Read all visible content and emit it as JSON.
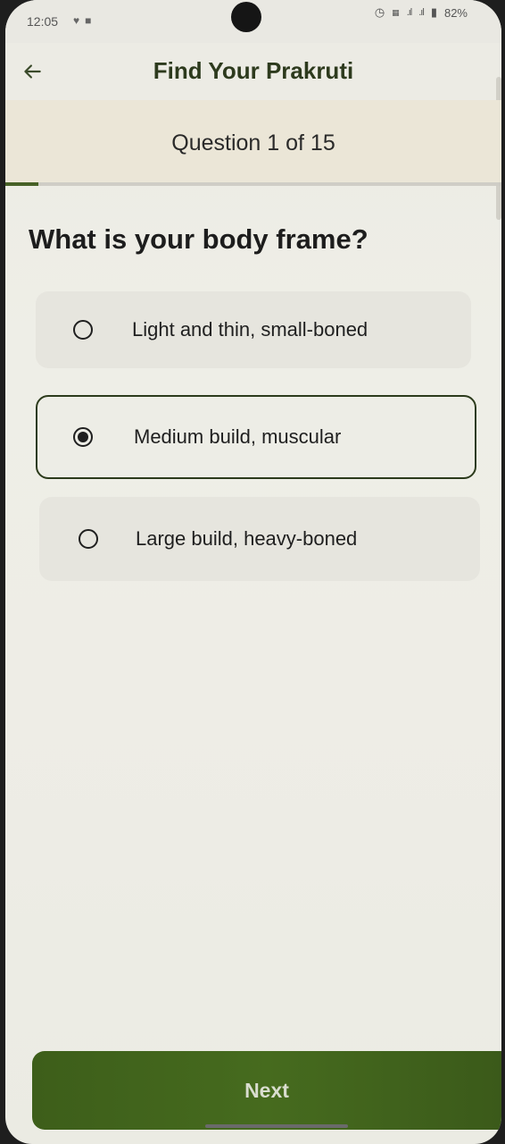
{
  "status_bar": {
    "time": "12:05",
    "battery": "82%",
    "left_icons": [
      "shield-icon",
      "notification-icon"
    ],
    "right_icons": [
      "alarm-icon",
      "volte-icon",
      "signal-icon",
      "signal-icon",
      "battery-icon"
    ]
  },
  "app_bar": {
    "title": "Find Your Prakruti",
    "back_icon": "arrow-left-icon"
  },
  "quiz": {
    "counter": "Question 1 of 15",
    "current_question": 1,
    "total_questions": 15,
    "progress_fraction": 0.0667,
    "question": "What is your body frame?",
    "options": [
      {
        "label": "Light and thin, small-boned",
        "selected": false
      },
      {
        "label": "Medium build, muscular",
        "selected": true
      },
      {
        "label": "Large build, heavy-boned",
        "selected": false
      }
    ]
  },
  "footer": {
    "next_label": "Next"
  },
  "colors": {
    "accent": "#466b1e",
    "title_text": "#2d3a1d",
    "background": "#ecebe4",
    "option_bg": "#e6e5de",
    "selected_border": "#2c3b1c"
  }
}
